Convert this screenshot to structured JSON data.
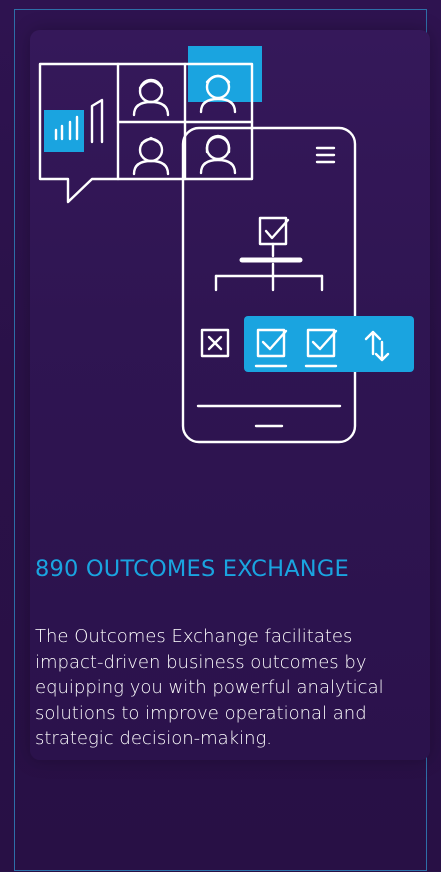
{
  "card": {
    "title": "890 OUTCOMES EXCHANGE",
    "description": "The Outcomes Exchange facilitates impact-driven business outcomes by equipping you with powerful analytical solutions to improve operational and strategic decision-making."
  },
  "illustration": {
    "icons": [
      "chat-bubble-icon",
      "bar-chart-icon",
      "user-avatar-icon",
      "phone-icon",
      "hamburger-menu-icon",
      "checkbox-checked-icon",
      "checkbox-unchecked-icon",
      "sort-arrows-icon"
    ]
  },
  "colors": {
    "background": "#2a1147",
    "accent": "#1aa4e0",
    "line": "#ffffff",
    "border": "#2e6fa8"
  }
}
